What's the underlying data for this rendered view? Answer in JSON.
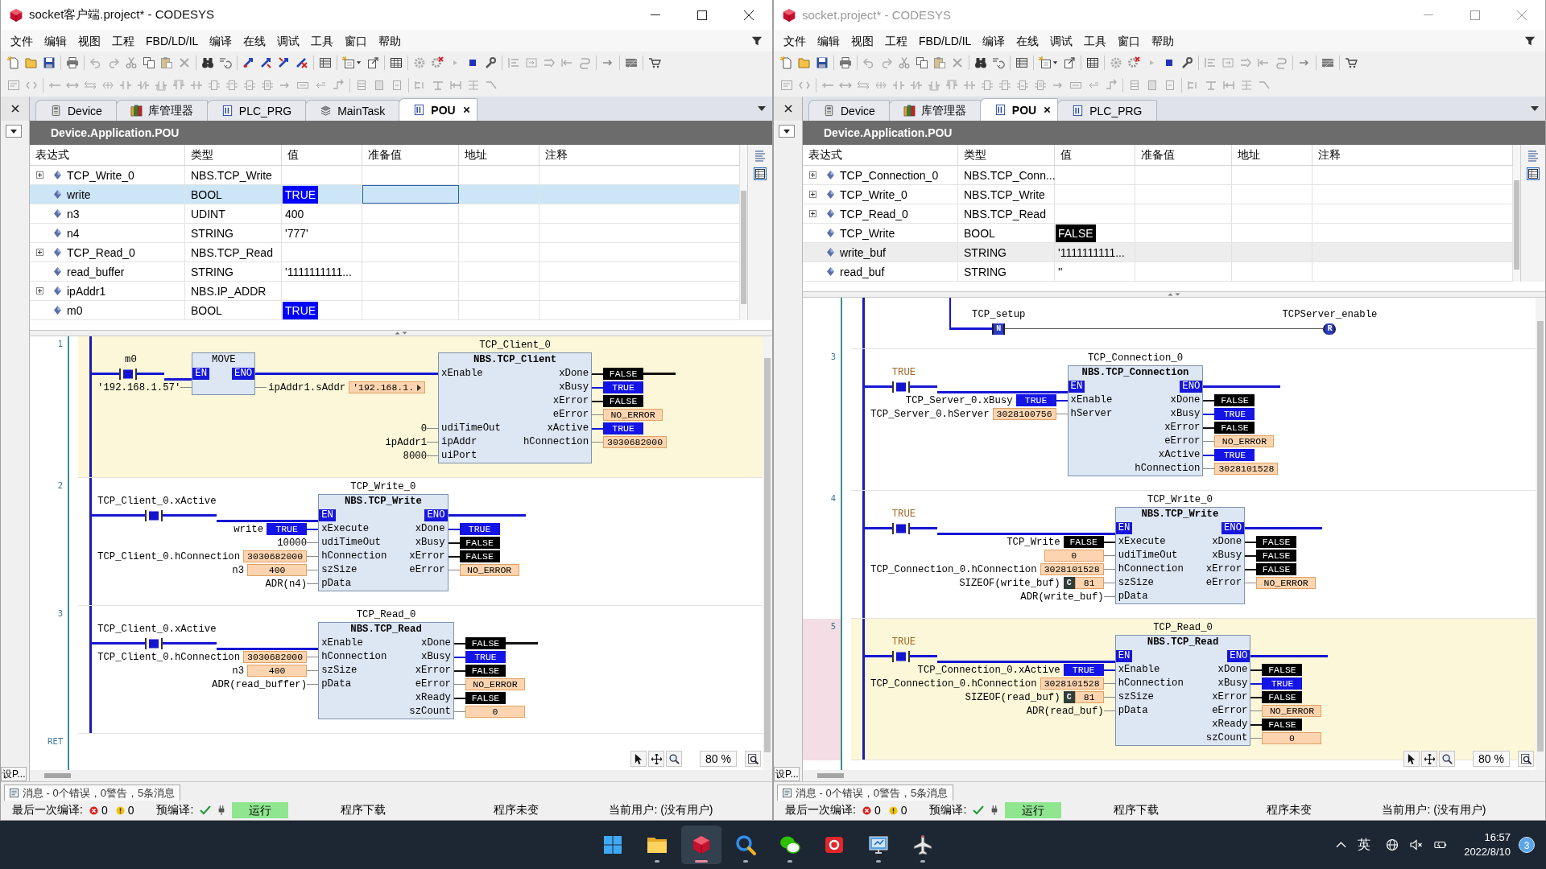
{
  "windows": [
    {
      "title": "socket客户端.project* - CODESYS",
      "active": true,
      "menu": [
        "文件",
        "编辑",
        "视图",
        "工程",
        "FBD/LD/IL",
        "编译",
        "在线",
        "调试",
        "工具",
        "窗口",
        "帮助"
      ],
      "tabs": [
        {
          "label": "Device",
          "kind": "device",
          "selected": false
        },
        {
          "label": "库管理器",
          "kind": "library",
          "selected": false
        },
        {
          "label": "PLC_PRG",
          "kind": "pou",
          "selected": false
        },
        {
          "label": "MainTask",
          "kind": "task",
          "selected": false
        },
        {
          "label": "POU",
          "kind": "pou",
          "selected": true
        }
      ],
      "side_tab": "设P...",
      "path": "Device.Application.POU",
      "watch": {
        "columns": [
          "表达式",
          "类型",
          "值",
          "准备值",
          "地址",
          "注释"
        ],
        "rows": [
          {
            "expression": "TCP_Write_0",
            "type": "NBS.TCP_Write",
            "expandable": true,
            "selected": false
          },
          {
            "expression": "write",
            "type": "BOOL",
            "value": {
              "text": "TRUE",
              "kind": "bool_on"
            },
            "expandable": false,
            "selected": true
          },
          {
            "expression": "n3",
            "type": "UDINT",
            "value": {
              "text": "400",
              "kind": "plain"
            },
            "expandable": false,
            "selected": false
          },
          {
            "expression": "n4",
            "type": "STRING",
            "value": {
              "text": "'777'",
              "kind": "plain"
            },
            "expandable": false,
            "selected": false
          },
          {
            "expression": "TCP_Read_0",
            "type": "NBS.TCP_Read",
            "expandable": true,
            "selected": false
          },
          {
            "expression": "read_buffer",
            "type": "STRING",
            "value": {
              "text": "'1111111111...",
              "kind": "plain"
            },
            "expandable": false,
            "selected": false
          },
          {
            "expression": "ipAddr1",
            "type": "NBS.IP_ADDR",
            "expandable": true,
            "selected": false
          },
          {
            "expression": "m0",
            "type": "BOOL",
            "value": {
              "text": "TRUE",
              "kind": "bool_on"
            },
            "expandable": false,
            "selected": false
          }
        ]
      },
      "ladder": {
        "networks": [
          {
            "kind": "blocks",
            "number": "1",
            "selected": true,
            "marked": false,
            "contact": {
              "label": "m0",
              "literal": false,
              "on": true
            },
            "blocks": [
              {
                "kind": "operator",
                "type": "MOVE",
                "rows": [
                  {
                    "kind": "en",
                    "input": {
                      "pin": "EN"
                    },
                    "output": {
                      "pin": "ENO"
                    }
                  },
                  {
                    "kind": "pins",
                    "input": {
                      "label": "'192.168.1.57'"
                    },
                    "output": {
                      "label": "ipAddr1.sAddr",
                      "value": {
                        "text": "'192.168.1.",
                        "kind": "plain",
                        "more": true
                      }
                    }
                  }
                ]
              },
              {
                "kind": "fb",
                "instance": "TCP_Client_0",
                "type": "NBS.TCP_Client",
                "rows": [
                  {
                    "kind": "pins",
                    "input": {
                      "pin": "xEnable"
                    },
                    "output": {
                      "pin": "xDone",
                      "value": {
                        "text": "FALSE",
                        "kind": "bool_off"
                      },
                      "wired": true
                    }
                  },
                  {
                    "kind": "pins",
                    "output": {
                      "pin": "xBusy",
                      "value": {
                        "text": "TRUE",
                        "kind": "bool_on"
                      }
                    }
                  },
                  {
                    "kind": "pins",
                    "output": {
                      "pin": "xError",
                      "value": {
                        "text": "FALSE",
                        "kind": "bool_off"
                      }
                    }
                  },
                  {
                    "kind": "pins",
                    "output": {
                      "pin": "eError",
                      "value": {
                        "text": "NO_ERROR",
                        "kind": "plain"
                      }
                    }
                  },
                  {
                    "kind": "pins",
                    "input": {
                      "pin": "udiTimeOut",
                      "label": "0"
                    },
                    "output": {
                      "pin": "xActive",
                      "value": {
                        "text": "TRUE",
                        "kind": "bool_on"
                      }
                    }
                  },
                  {
                    "kind": "pins",
                    "input": {
                      "pin": "ipAddr",
                      "label": "ipAddr1"
                    },
                    "output": {
                      "pin": "hConnection",
                      "value": {
                        "text": "3030682000",
                        "kind": "plain"
                      }
                    }
                  },
                  {
                    "kind": "pins",
                    "input": {
                      "pin": "uiPort",
                      "label": "8000"
                    }
                  }
                ]
              }
            ]
          },
          {
            "kind": "blocks",
            "number": "2",
            "selected": false,
            "marked": false,
            "contact": {
              "label": "TCP_Client_0.xActive",
              "literal": false,
              "on": true
            },
            "blocks": [
              {
                "kind": "fb",
                "instance": "TCP_Write_0",
                "type": "NBS.TCP_Write",
                "rows": [
                  {
                    "kind": "en",
                    "input": {
                      "pin": "EN"
                    },
                    "output": {
                      "pin": "ENO"
                    }
                  },
                  {
                    "kind": "pins",
                    "input": {
                      "pin": "xExecute",
                      "label": "write",
                      "value": {
                        "text": "TRUE",
                        "kind": "bool_on"
                      }
                    },
                    "output": {
                      "pin": "xDone",
                      "value": {
                        "text": "TRUE",
                        "kind": "bool_on"
                      }
                    }
                  },
                  {
                    "kind": "pins",
                    "input": {
                      "pin": "udiTimeOut",
                      "label": "10000"
                    },
                    "output": {
                      "pin": "xBusy",
                      "value": {
                        "text": "FALSE",
                        "kind": "bool_off"
                      }
                    }
                  },
                  {
                    "kind": "pins",
                    "input": {
                      "pin": "hConnection",
                      "label": "TCP_Client_0.hConnection",
                      "value": {
                        "text": "3030682000",
                        "kind": "plain"
                      }
                    },
                    "output": {
                      "pin": "xError",
                      "value": {
                        "text": "FALSE",
                        "kind": "bool_off"
                      }
                    }
                  },
                  {
                    "kind": "pins",
                    "input": {
                      "pin": "szSize",
                      "label": "n3",
                      "value": {
                        "text": "400",
                        "kind": "plain"
                      }
                    },
                    "output": {
                      "pin": "eError",
                      "value": {
                        "text": "NO_ERROR",
                        "kind": "plain"
                      }
                    }
                  },
                  {
                    "kind": "pins",
                    "input": {
                      "pin": "pData",
                      "label": "ADR(n4)"
                    }
                  }
                ]
              }
            ]
          },
          {
            "kind": "blocks",
            "number": "3",
            "selected": false,
            "marked": false,
            "contact": {
              "label": "TCP_Client_0.xActive",
              "literal": false,
              "on": true
            },
            "blocks": [
              {
                "kind": "fb",
                "instance": "TCP_Read_0",
                "type": "NBS.TCP_Read",
                "rows": [
                  {
                    "kind": "pins",
                    "input": {
                      "pin": "xEnable"
                    },
                    "output": {
                      "pin": "xDone",
                      "value": {
                        "text": "FALSE",
                        "kind": "bool_off"
                      },
                      "wired": true
                    }
                  },
                  {
                    "kind": "pins",
                    "input": {
                      "pin": "hConnection",
                      "label": "TCP_Client_0.hConnection",
                      "value": {
                        "text": "3030682000",
                        "kind": "plain"
                      }
                    },
                    "output": {
                      "pin": "xBusy",
                      "value": {
                        "text": "TRUE",
                        "kind": "bool_on"
                      }
                    }
                  },
                  {
                    "kind": "pins",
                    "input": {
                      "pin": "szSize",
                      "label": "n3",
                      "value": {
                        "text": "400",
                        "kind": "plain"
                      }
                    },
                    "output": {
                      "pin": "xError",
                      "value": {
                        "text": "FALSE",
                        "kind": "bool_off"
                      }
                    }
                  },
                  {
                    "kind": "pins",
                    "input": {
                      "pin": "pData",
                      "label": "ADR(read_buffer)"
                    },
                    "output": {
                      "pin": "eError",
                      "value": {
                        "text": "NO_ERROR",
                        "kind": "plain"
                      }
                    }
                  },
                  {
                    "kind": "pins",
                    "output": {
                      "pin": "xReady",
                      "value": {
                        "text": "FALSE",
                        "kind": "bool_off"
                      }
                    }
                  },
                  {
                    "kind": "pins",
                    "output": {
                      "pin": "szCount",
                      "value": {
                        "text": "0",
                        "kind": "plain"
                      }
                    }
                  }
                ]
              }
            ]
          }
        ],
        "end_label": "RET",
        "zoom": "80 %"
      },
      "messages": "消息 - 0个错误，0警告，5条消息",
      "status": {
        "build_label": "最后一次编译:",
        "errors": "0",
        "warnings": "0",
        "precompile_label": "预编译:",
        "precompile_ok": true,
        "run_state": "运行",
        "download": "程序下载",
        "program_state": "程序未变",
        "user": "当前用户: (没有用户)"
      }
    },
    {
      "title": "socket.project* - CODESYS",
      "active": false,
      "menu": [
        "文件",
        "编辑",
        "视图",
        "工程",
        "FBD/LD/IL",
        "编译",
        "在线",
        "调试",
        "工具",
        "窗口",
        "帮助"
      ],
      "tabs": [
        {
          "label": "Device",
          "kind": "device",
          "selected": false
        },
        {
          "label": "库管理器",
          "kind": "library",
          "selected": false
        },
        {
          "label": "POU",
          "kind": "pou",
          "selected": true
        },
        {
          "label": "PLC_PRG",
          "kind": "pou",
          "selected": false
        }
      ],
      "side_tab": "设P...",
      "path": "Device.Application.POU",
      "watch": {
        "columns": [
          "表达式",
          "类型",
          "值",
          "准备值",
          "地址",
          "注释"
        ],
        "rows": [
          {
            "expression": "TCP_Connection_0",
            "type": "NBS.TCP_Conn...",
            "expandable": true,
            "selected": false
          },
          {
            "expression": "TCP_Write_0",
            "type": "NBS.TCP_Write",
            "expandable": true,
            "selected": false
          },
          {
            "expression": "TCP_Read_0",
            "type": "NBS.TCP_Read",
            "expandable": true,
            "selected": false
          },
          {
            "expression": "TCP_Write",
            "type": "BOOL",
            "value": {
              "text": "FALSE",
              "kind": "bool_off"
            },
            "expandable": false,
            "selected": false
          },
          {
            "expression": "write_buf",
            "type": "STRING",
            "value": {
              "text": "'1111111111...",
              "kind": "plain"
            },
            "expandable": false,
            "selected": true
          },
          {
            "expression": "read_buf",
            "type": "STRING",
            "value": {
              "text": "''",
              "kind": "plain"
            },
            "expandable": false,
            "selected": false
          }
        ]
      },
      "ladder": {
        "networks": [
          {
            "kind": "coil_rung",
            "selected": false,
            "marked": false,
            "contact": {
              "label": "TCP_setup",
              "letter": "N",
              "on": false
            },
            "coil": {
              "label": "TCPServer_enable",
              "letter": "R"
            }
          },
          {
            "kind": "blocks",
            "number": "3",
            "selected": false,
            "marked": false,
            "contact": {
              "label": "TRUE",
              "literal": true,
              "on": true
            },
            "blocks": [
              {
                "kind": "fb",
                "instance": "TCP_Connection_0",
                "type": "NBS.TCP_Connection",
                "rows": [
                  {
                    "kind": "en",
                    "input": {
                      "pin": "EN"
                    },
                    "output": {
                      "pin": "ENO"
                    }
                  },
                  {
                    "kind": "pins",
                    "input": {
                      "pin": "xEnable",
                      "label": "TCP_Server_0.xBusy",
                      "value": {
                        "text": "TRUE",
                        "kind": "bool_on"
                      }
                    },
                    "output": {
                      "pin": "xDone",
                      "value": {
                        "text": "FALSE",
                        "kind": "bool_off"
                      }
                    }
                  },
                  {
                    "kind": "pins",
                    "input": {
                      "pin": "hServer",
                      "label": "TCP_Server_0.hServer",
                      "value": {
                        "text": "3028100756",
                        "kind": "plain"
                      }
                    },
                    "output": {
                      "pin": "xBusy",
                      "value": {
                        "text": "TRUE",
                        "kind": "bool_on"
                      }
                    }
                  },
                  {
                    "kind": "pins",
                    "output": {
                      "pin": "xError",
                      "value": {
                        "text": "FALSE",
                        "kind": "bool_off"
                      }
                    }
                  },
                  {
                    "kind": "pins",
                    "output": {
                      "pin": "eError",
                      "value": {
                        "text": "NO_ERROR",
                        "kind": "plain"
                      }
                    }
                  },
                  {
                    "kind": "pins",
                    "output": {
                      "pin": "xActive",
                      "value": {
                        "text": "TRUE",
                        "kind": "bool_on"
                      }
                    }
                  },
                  {
                    "kind": "pins",
                    "output": {
                      "pin": "hConnection",
                      "value": {
                        "text": "3028101528",
                        "kind": "plain"
                      }
                    }
                  }
                ]
              }
            ]
          },
          {
            "kind": "blocks",
            "number": "4",
            "selected": false,
            "marked": false,
            "contact": {
              "label": "TRUE",
              "literal": true,
              "on": true
            },
            "blocks": [
              {
                "kind": "fb",
                "instance": "TCP_Write_0",
                "type": "NBS.TCP_Write",
                "rows": [
                  {
                    "kind": "en",
                    "input": {
                      "pin": "EN"
                    },
                    "output": {
                      "pin": "ENO"
                    }
                  },
                  {
                    "kind": "pins",
                    "input": {
                      "pin": "xExecute",
                      "label": "TCP_Write",
                      "value": {
                        "text": "FALSE",
                        "kind": "bool_off"
                      }
                    },
                    "output": {
                      "pin": "xDone",
                      "value": {
                        "text": "FALSE",
                        "kind": "bool_off"
                      }
                    }
                  },
                  {
                    "kind": "pins",
                    "input": {
                      "pin": "udiTimeOut",
                      "value": {
                        "text": "0",
                        "kind": "plain"
                      }
                    },
                    "output": {
                      "pin": "xBusy",
                      "value": {
                        "text": "FALSE",
                        "kind": "bool_off"
                      }
                    }
                  },
                  {
                    "kind": "pins",
                    "input": {
                      "pin": "hConnection",
                      "label": "TCP_Connection_0.hConnection",
                      "value": {
                        "text": "3028101528",
                        "kind": "plain"
                      }
                    },
                    "output": {
                      "pin": "xError",
                      "value": {
                        "text": "FALSE",
                        "kind": "bool_off"
                      }
                    }
                  },
                  {
                    "kind": "pins",
                    "input": {
                      "pin": "szSize",
                      "label": "SIZEOF(write_buf)",
                      "badge": "C",
                      "value": {
                        "text": "81",
                        "kind": "plain"
                      }
                    },
                    "output": {
                      "pin": "eError",
                      "value": {
                        "text": "NO_ERROR",
                        "kind": "plain"
                      }
                    }
                  },
                  {
                    "kind": "pins",
                    "input": {
                      "pin": "pData",
                      "label": "ADR(write_buf)"
                    }
                  }
                ]
              }
            ]
          },
          {
            "kind": "blocks",
            "number": "5",
            "selected": true,
            "marked": true,
            "contact": {
              "label": "TRUE",
              "literal": true,
              "on": true
            },
            "blocks": [
              {
                "kind": "fb",
                "instance": "TCP_Read_0",
                "type": "NBS.TCP_Read",
                "rows": [
                  {
                    "kind": "en",
                    "input": {
                      "pin": "EN"
                    },
                    "output": {
                      "pin": "ENO"
                    }
                  },
                  {
                    "kind": "pins",
                    "input": {
                      "pin": "xEnable",
                      "label": "TCP_Connection_0.xActive",
                      "value": {
                        "text": "TRUE",
                        "kind": "bool_on"
                      }
                    },
                    "output": {
                      "pin": "xDone",
                      "value": {
                        "text": "FALSE",
                        "kind": "bool_off"
                      }
                    }
                  },
                  {
                    "kind": "pins",
                    "input": {
                      "pin": "hConnection",
                      "label": "TCP_Connection_0.hConnection",
                      "value": {
                        "text": "3028101528",
                        "kind": "plain"
                      }
                    },
                    "output": {
                      "pin": "xBusy",
                      "value": {
                        "text": "TRUE",
                        "kind": "bool_on"
                      }
                    }
                  },
                  {
                    "kind": "pins",
                    "input": {
                      "pin": "szSize",
                      "label": "SIZEOF(read_buf)",
                      "badge": "C",
                      "value": {
                        "text": "81",
                        "kind": "plain"
                      }
                    },
                    "output": {
                      "pin": "xError",
                      "value": {
                        "text": "FALSE",
                        "kind": "bool_off"
                      }
                    }
                  },
                  {
                    "kind": "pins",
                    "input": {
                      "pin": "pData",
                      "label": "ADR(read_buf)"
                    },
                    "output": {
                      "pin": "eError",
                      "value": {
                        "text": "NO_ERROR",
                        "kind": "plain"
                      }
                    }
                  },
                  {
                    "kind": "pins",
                    "output": {
                      "pin": "xReady",
                      "value": {
                        "text": "FALSE",
                        "kind": "bool_off"
                      }
                    }
                  },
                  {
                    "kind": "pins",
                    "output": {
                      "pin": "szCount",
                      "value": {
                        "text": "0",
                        "kind": "plain"
                      }
                    }
                  }
                ]
              }
            ]
          }
        ],
        "zoom": "80 %"
      },
      "messages": "消息 - 0个错误，0警告，5条消息",
      "status": {
        "build_label": "最后一次编译:",
        "errors": "0",
        "warnings": "0",
        "precompile_label": "预编译:",
        "precompile_ok": true,
        "run_state": "运行",
        "download": "程序下载",
        "program_state": "程序未变",
        "user": "当前用户: (没有用户)"
      }
    }
  ],
  "taskbar": {
    "apps": [
      {
        "kind": "start",
        "running": false,
        "active": false
      },
      {
        "kind": "explorer",
        "running": true,
        "active": false
      },
      {
        "kind": "codesys",
        "running": true,
        "active": true
      },
      {
        "kind": "search",
        "running": true,
        "active": false
      },
      {
        "kind": "chat",
        "running": true,
        "active": false
      },
      {
        "kind": "office",
        "running": false,
        "active": false
      },
      {
        "kind": "remote",
        "running": true,
        "active": false
      },
      {
        "kind": "tool",
        "running": true,
        "active": false
      }
    ],
    "input_method": "英",
    "time": "16:57",
    "date": "2022/8/10",
    "notifications": "3"
  }
}
